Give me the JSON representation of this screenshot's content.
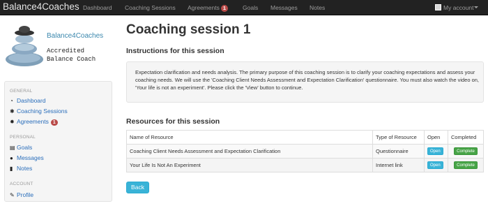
{
  "navbar": {
    "brand": "Balance4Coaches",
    "items": [
      {
        "label": "Dashboard"
      },
      {
        "label": "Coaching Sessions"
      },
      {
        "label": "Agreements",
        "badge": "1"
      },
      {
        "label": "Goals"
      },
      {
        "label": "Messages"
      },
      {
        "label": "Notes"
      }
    ],
    "account_label": "My account"
  },
  "logo": {
    "title": "Balance4Coaches",
    "subtitle_line1": "Accredited",
    "subtitle_line2": "Balance Coach"
  },
  "sidebar": {
    "sections": [
      {
        "header": "GENERAL",
        "items": [
          {
            "label": "Dashboard",
            "icon": "dashboard-icon"
          },
          {
            "label": "Coaching Sessions",
            "icon": "cogs-icon"
          },
          {
            "label": "Agreements",
            "icon": "cog-icon",
            "badge": "1"
          }
        ]
      },
      {
        "header": "PERSONAL",
        "items": [
          {
            "label": "Goals",
            "icon": "tasks-icon"
          },
          {
            "label": "Messages",
            "icon": "comments-icon"
          },
          {
            "label": "Notes",
            "icon": "file-icon"
          }
        ]
      },
      {
        "header": "ACCOUNT",
        "items": [
          {
            "label": "Profile",
            "icon": "edit-icon"
          }
        ]
      }
    ]
  },
  "main": {
    "title": "Coaching session 1",
    "instructions_heading": "Instructions for this session",
    "instructions_text": "Expectation clarification and needs analysis. The primary purpose of this coaching session is to clarify your coaching expectations and assess your coaching needs. We will use the 'Coaching Client Needs Assessment and Expectation Clarification' questionnaire. You must also watch the video on, 'Your life is not an experiment'. Please click the 'View' button to continue.",
    "resources_heading": "Resources for this session",
    "table": {
      "headers": [
        "Name of Resource",
        "Type of Resource",
        "Open",
        "Completed"
      ],
      "rows": [
        {
          "name": "Coaching Client Needs Assessment and Expectation Clarification",
          "type": "Questionnaire",
          "open": "Open",
          "completed": "Complete"
        },
        {
          "name": "Your Life Is Not An Experiment",
          "type": "Internet link",
          "open": "Open",
          "completed": "Complete"
        }
      ]
    },
    "back_label": "Back"
  },
  "colors": {
    "navbar_bg": "#222222",
    "link": "#2a6ebb",
    "badge": "#b94a48",
    "info_button": "#39b3d7",
    "success_button": "#47a447"
  }
}
